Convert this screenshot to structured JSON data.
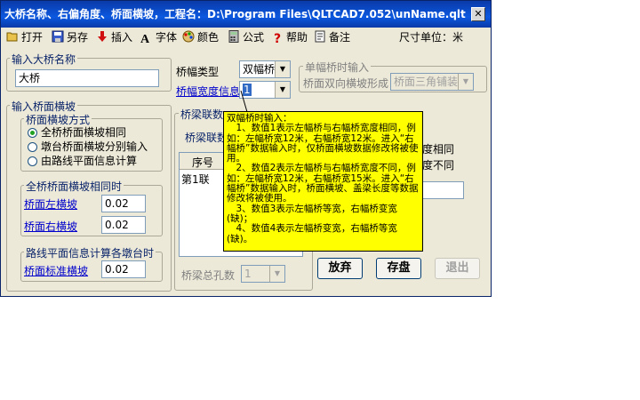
{
  "window": {
    "title": "大桥名称、右偏角度、桥面横坡，工程名：D:\\Program Files\\QLTCAD7.052\\unName.qlt",
    "close_symbol": "✕"
  },
  "toolbar": {
    "open": "打开",
    "save_as": "另存",
    "insert": "插入",
    "font": "字体",
    "color": "颜色",
    "formula": "公式",
    "help": "帮助",
    "notes": "备注",
    "unit_label": "尺寸单位：米"
  },
  "bridge_name": {
    "group_label": "输入大桥名称",
    "value": "大桥"
  },
  "cross_slope": {
    "group_label": "输入桥面横坡",
    "mode_group_label": "桥面横坡方式",
    "options": [
      "全桥桥面横坡相同",
      "墩台桥面横坡分别输入",
      "由路线平面信息计算"
    ],
    "selected_index": 0,
    "same_group_label": "全桥桥面横坡相同时",
    "left_label": "桥面左横坡",
    "left_value": "0.02",
    "right_label": "桥面右横坡",
    "right_value": "0.02",
    "route_group_label": "路线平面信息计算各墩台时",
    "std_label": "桥面标准横坡",
    "std_value": "0.02"
  },
  "width": {
    "type_label": "桥幅类型",
    "type_value": "双幅桥",
    "info_label": "桥幅宽度信息",
    "info_value": "1"
  },
  "single": {
    "group_label": "单幅桥时输入",
    "slope_label": "桥面双向横坡形成",
    "slope_value": "桥面三角铺装"
  },
  "joints": {
    "group_label": "桥梁联数",
    "inner_label": "桥梁联数",
    "col_header": "序号",
    "rows": [
      "第1联"
    ],
    "total_label": "桥梁总孔数",
    "total_value": "1",
    "hidden_right_1": "度相同",
    "hidden_right_2": "度不同"
  },
  "buttons": {
    "discard": "放弃",
    "save": "存盘",
    "exit": "退出"
  },
  "tooltip": {
    "lines": [
      "双幅桥时输入：",
      "　1、数值1表示左幅桥与右幅桥宽度相同，例如：左幅桥宽12米，右幅桥宽12米。进入“右幅桥”数据输入时，仅桥面横坡数据修改将被使用。",
      "　2、数值2表示左幅桥与右幅桥宽度不同，例如：左幅桥宽12米，右幅桥宽15米。进入“右幅桥”数据输入时，桥面横坡、盖梁长度等数据修改将被使用。",
      "　3、数值3表示左幅桥等宽，右幅桥变宽(缺)；",
      "　4、数值4表示左幅桥变宽，右幅桥等宽(缺)。"
    ]
  },
  "icons": {
    "open": "folder-open-icon",
    "save_as": "save-as-icon",
    "insert": "insert-arrow-icon",
    "font": "font-icon",
    "color": "color-palette-icon",
    "formula": "calculator-icon",
    "help": "help-question-icon",
    "notes": "notes-icon"
  },
  "colors": {
    "titlebar": "#0b58e0",
    "tooltip_bg": "#ffff00",
    "link": "#0000cc"
  }
}
